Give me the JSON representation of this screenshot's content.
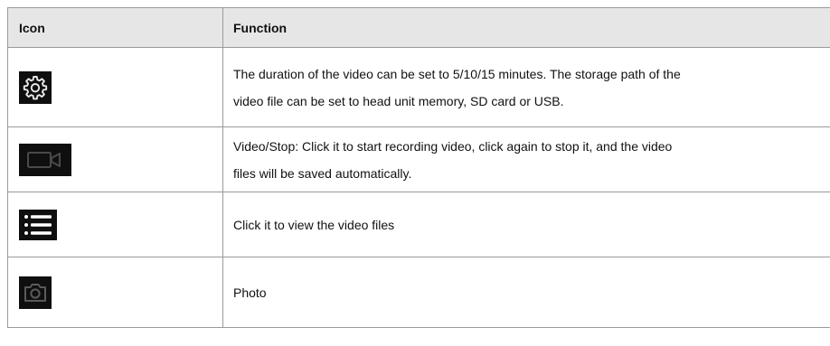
{
  "table": {
    "headers": {
      "icon": "Icon",
      "function": "Function"
    },
    "rows": [
      {
        "icon": "gear-icon",
        "lines": [
          "The duration of the video can be set to 5/10/15 minutes. The storage path of the",
          "video file can be set to head unit memory, SD card or USB."
        ]
      },
      {
        "icon": "video-camera-icon",
        "lines": [
          "Video/Stop: Click it to start recording video, click again to stop it, and the video",
          "files will be saved automatically."
        ]
      },
      {
        "icon": "list-icon",
        "lines": [
          "Click it to view the video files"
        ]
      },
      {
        "icon": "camera-icon",
        "lines": [
          "Photo"
        ]
      }
    ]
  },
  "colors": {
    "icon_background": "#0f0f0f",
    "gear_icon": "#e8e8e8",
    "video_icon": "#4a4a4a",
    "list_icon": "#ffffff",
    "camera_icon": "#5a5a5a",
    "header_background": "#e6e6e6",
    "border": "#9a9a9a"
  }
}
